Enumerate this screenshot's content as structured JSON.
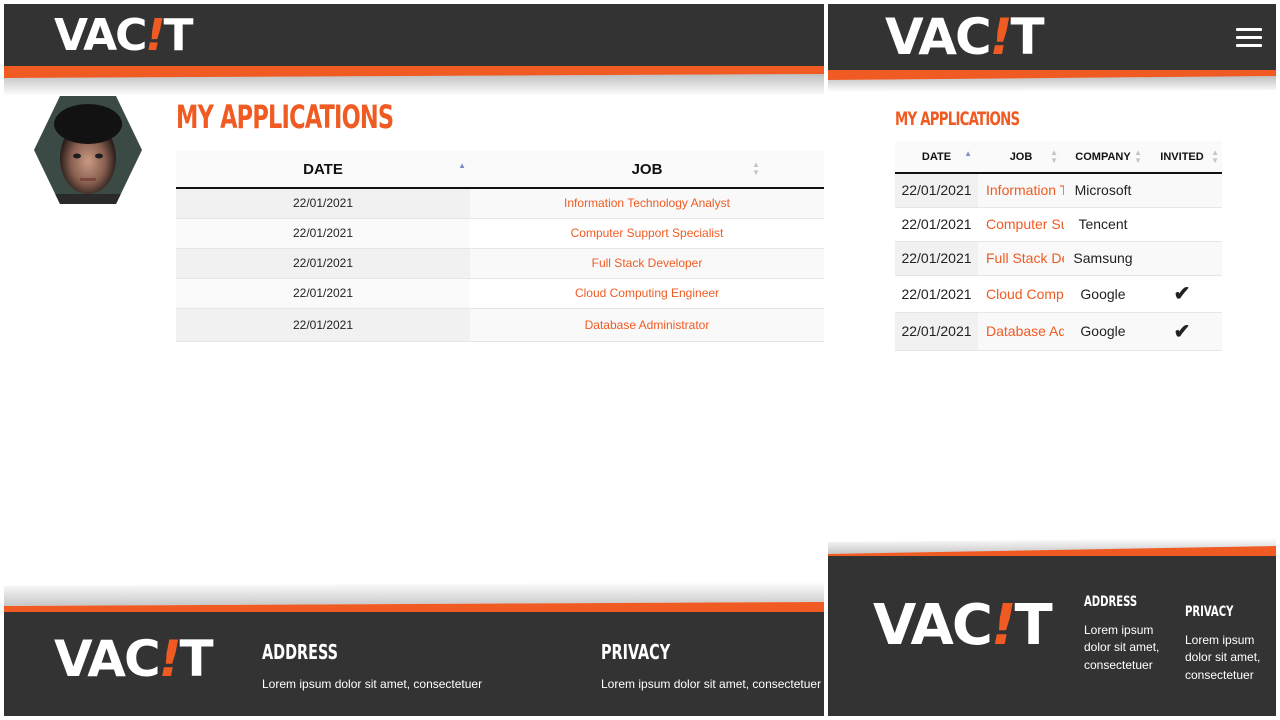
{
  "brand": {
    "logo_left": "VAC",
    "logo_bang": "!",
    "logo_right": "T"
  },
  "colors": {
    "accent": "#ef5b22",
    "dark": "#333333",
    "sort_active": "#7f8bc9"
  },
  "page": {
    "title": "MY APPLICATIONS"
  },
  "desktop_table": {
    "headers": [
      "DATE",
      "JOB"
    ],
    "rows": [
      {
        "date": "22/01/2021",
        "job": "Information Technology Analyst"
      },
      {
        "date": "22/01/2021",
        "job": "Computer Support Specialist"
      },
      {
        "date": "22/01/2021",
        "job": "Full Stack Developer"
      },
      {
        "date": "22/01/2021",
        "job": "Cloud Computing Engineer"
      },
      {
        "date": "22/01/2021",
        "job": "Database Administrator"
      }
    ]
  },
  "mobile_table": {
    "headers": [
      "DATE",
      "JOB",
      "COMPANY",
      "INVITED"
    ],
    "rows": [
      {
        "date": "22/01/2021",
        "job": "Information Technology Analyst",
        "company": "Microsoft",
        "invited": ""
      },
      {
        "date": "22/01/2021",
        "job": "Computer Support Specialist",
        "company": "Tencent",
        "invited": ""
      },
      {
        "date": "22/01/2021",
        "job": "Full Stack Developer",
        "company": "Samsung",
        "invited": ""
      },
      {
        "date": "22/01/2021",
        "job": "Cloud Computing Engineer",
        "company": "Google",
        "invited": "✔"
      },
      {
        "date": "22/01/2021",
        "job": "Database Administrator",
        "company": "Google",
        "invited": "✔"
      }
    ]
  },
  "footer": {
    "address_title": "ADDRESS",
    "address_text": "Lorem ipsum dolor sit amet, consectetuer",
    "privacy_title": "PRIVACY",
    "privacy_text": "Lorem ipsum dolor sit amet, consectetuer"
  }
}
